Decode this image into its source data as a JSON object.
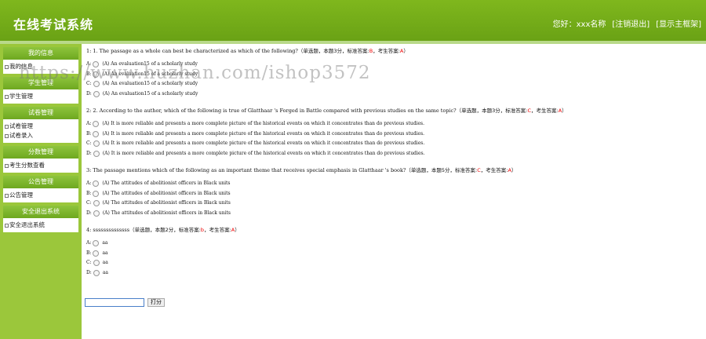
{
  "header": {
    "title": "在线考试系统",
    "greeting": "您好：xxx名称",
    "logout": "[注销退出]",
    "show_frame": "[显示主框架]"
  },
  "sidebar": [
    {
      "heading": "我的信息",
      "items": [
        "我的信息"
      ]
    },
    {
      "heading": "学生管理",
      "items": [
        "学生管理"
      ]
    },
    {
      "heading": "试卷管理",
      "items": [
        "试卷管理",
        "试卷录入"
      ]
    },
    {
      "heading": "分数管理",
      "items": [
        "考生分数查看"
      ]
    },
    {
      "heading": "公告管理",
      "items": [
        "公告管理"
      ]
    },
    {
      "heading": "安全退出系统",
      "items": [
        "安全退出系统"
      ]
    }
  ],
  "questions": [
    {
      "text": "1: 1. The passage as a whole can best be characterized as which of the following?",
      "meta_prefix": "（单选题，本题3分，标准答案:",
      "standard": "B",
      "meta_mid": "，考生答案:",
      "answer": "A",
      "meta_suffix": "）",
      "options": [
        {
          "letter": "A:",
          "text": "(A)  An evaluation15 of a scholarly study"
        },
        {
          "letter": "B:",
          "text": "(A)  An evaluation15 of a scholarly study"
        },
        {
          "letter": "C:",
          "text": "(A)  An evaluation15 of a scholarly study"
        },
        {
          "letter": "D:",
          "text": "(A)  An evaluation15 of a scholarly study"
        }
      ]
    },
    {
      "text": "2: 2. According to the author, which of the following is true of Glatthaar 's Forged in Battle compared with previous studies  on the same topic?",
      "meta_prefix": "（单选题，本题3分，标准答案:",
      "standard": "C",
      "meta_mid": "，考生答案:",
      "answer": "A",
      "meta_suffix": "）",
      "options": [
        {
          "letter": "A:",
          "text": "(A)  It is more reliable and presents a more complete picture of the historical events on which it concentrates than do previous studies."
        },
        {
          "letter": "B:",
          "text": "(A)  It is more reliable and presents a more complete picture of the historical events on which it concentrates than do previous studies."
        },
        {
          "letter": "C:",
          "text": "(A)  It is more reliable and presents a more complete picture of the historical events on which it concentrates than do previous studies."
        },
        {
          "letter": "D:",
          "text": "(A)  It is more reliable and presents a more complete picture of the historical events on which it concentrates than do previous studies."
        }
      ]
    },
    {
      "text": "3: The passage mentions which of the following as an  important theme that receives special emphasis in Glatthaar 's book?",
      "meta_prefix": "（单选题，本题5分，标准答案:",
      "standard": "C",
      "meta_mid": "，考生答案:",
      "answer": "A",
      "meta_suffix": "）",
      "options": [
        {
          "letter": "A:",
          "text": "(A)  The attitudes of abolitionist officers in Black units"
        },
        {
          "letter": "B:",
          "text": "(A)  The attitudes of abolitionist officers in Black units"
        },
        {
          "letter": "C:",
          "text": "(A)  The attitudes of abolitionist officers in Black units"
        },
        {
          "letter": "D:",
          "text": "(A)  The attitudes of abolitionist officers in Black units"
        }
      ]
    },
    {
      "text": "4: ssssssssssssss",
      "meta_prefix": "（单选题，本题2分，标准答案:",
      "standard": "b",
      "meta_mid": "，考生答案:",
      "answer": "A",
      "meta_suffix": "）",
      "options": [
        {
          "letter": "A:",
          "text": "aa"
        },
        {
          "letter": "B:",
          "text": "aa"
        },
        {
          "letter": "C:",
          "text": "aa"
        },
        {
          "letter": "D:",
          "text": "aa"
        }
      ]
    }
  ],
  "submit": {
    "input_value": "",
    "button_label": "打分"
  },
  "watermark": "https://www.huzhan.com/ishop3572",
  "colors": {
    "brand": "#76b01a",
    "accent_red": "#e00000"
  }
}
